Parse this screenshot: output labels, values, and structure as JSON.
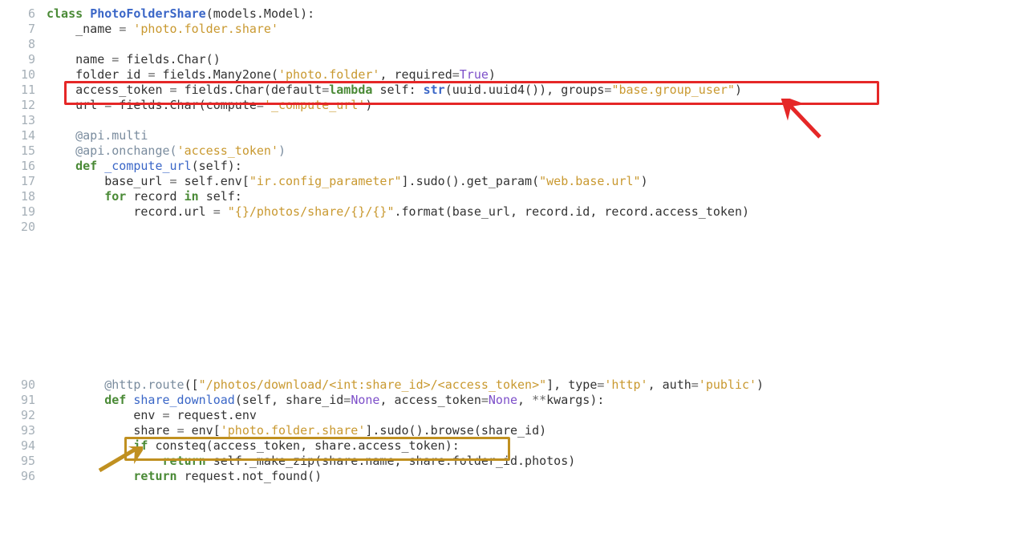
{
  "block1": {
    "lines": [
      {
        "n": 6,
        "tokens": [
          {
            "t": "class ",
            "c": "kw"
          },
          {
            "t": "PhotoFolderShare",
            "c": "cls"
          },
          {
            "t": "(models.Model):",
            "c": "nm"
          }
        ]
      },
      {
        "n": 7,
        "tokens": [
          {
            "t": "    _name ",
            "c": "nm"
          },
          {
            "t": "=",
            "c": "op"
          },
          {
            "t": " ",
            "c": "nm"
          },
          {
            "t": "'photo.folder.share'",
            "c": "str"
          }
        ]
      },
      {
        "n": 8,
        "tokens": [
          {
            "t": "",
            "c": "nm"
          }
        ]
      },
      {
        "n": 9,
        "tokens": [
          {
            "t": "    name ",
            "c": "nm"
          },
          {
            "t": "=",
            "c": "op"
          },
          {
            "t": " fields.Char()",
            "c": "nm"
          }
        ]
      },
      {
        "n": 10,
        "tokens": [
          {
            "t": "    folder_id ",
            "c": "nm"
          },
          {
            "t": "=",
            "c": "op"
          },
          {
            "t": " fields.Many2one(",
            "c": "nm"
          },
          {
            "t": "'photo.folder'",
            "c": "str"
          },
          {
            "t": ", required",
            "c": "nm"
          },
          {
            "t": "=",
            "c": "op"
          },
          {
            "t": "True",
            "c": "lit"
          },
          {
            "t": ")",
            "c": "nm"
          }
        ]
      },
      {
        "n": 11,
        "tokens": [
          {
            "t": "    access_token ",
            "c": "nm"
          },
          {
            "t": "=",
            "c": "op"
          },
          {
            "t": " fields.Char(default",
            "c": "nm"
          },
          {
            "t": "=",
            "c": "op"
          },
          {
            "t": "lambda ",
            "c": "kw"
          },
          {
            "t": "self",
            "c": "nm"
          },
          {
            "t": ": ",
            "c": "nm"
          },
          {
            "t": "str",
            "c": "cls"
          },
          {
            "t": "(uuid.uuid4()), groups",
            "c": "nm"
          },
          {
            "t": "=",
            "c": "op"
          },
          {
            "t": "\"base.group_user\"",
            "c": "str"
          },
          {
            "t": ")",
            "c": "nm"
          }
        ]
      },
      {
        "n": 12,
        "tokens": [
          {
            "t": "    url ",
            "c": "nm"
          },
          {
            "t": "=",
            "c": "op"
          },
          {
            "t": " fields.Char(compute",
            "c": "nm"
          },
          {
            "t": "=",
            "c": "op"
          },
          {
            "t": "'_compute_url'",
            "c": "str"
          },
          {
            "t": ")",
            "c": "nm"
          }
        ]
      },
      {
        "n": 13,
        "tokens": [
          {
            "t": "",
            "c": "nm"
          }
        ]
      },
      {
        "n": 14,
        "tokens": [
          {
            "t": "    ",
            "c": "nm"
          },
          {
            "t": "@api.multi",
            "c": "dec"
          }
        ]
      },
      {
        "n": 15,
        "tokens": [
          {
            "t": "    ",
            "c": "nm"
          },
          {
            "t": "@api.onchange",
            "c": "dec"
          },
          {
            "t": "(",
            "c": "dec"
          },
          {
            "t": "'access_token'",
            "c": "str"
          },
          {
            "t": ")",
            "c": "dec"
          }
        ]
      },
      {
        "n": 16,
        "tokens": [
          {
            "t": "    ",
            "c": "nm"
          },
          {
            "t": "def ",
            "c": "kw"
          },
          {
            "t": "_compute_url",
            "c": "fn"
          },
          {
            "t": "(",
            "c": "nm"
          },
          {
            "t": "self",
            "c": "nm"
          },
          {
            "t": "):",
            "c": "nm"
          }
        ]
      },
      {
        "n": 17,
        "tokens": [
          {
            "t": "        base_url ",
            "c": "nm"
          },
          {
            "t": "=",
            "c": "op"
          },
          {
            "t": " self.env[",
            "c": "nm"
          },
          {
            "t": "\"ir.config_parameter\"",
            "c": "str"
          },
          {
            "t": "].sudo().get_param(",
            "c": "nm"
          },
          {
            "t": "\"web.base.url\"",
            "c": "str"
          },
          {
            "t": ")",
            "c": "nm"
          }
        ]
      },
      {
        "n": 18,
        "tokens": [
          {
            "t": "        ",
            "c": "nm"
          },
          {
            "t": "for ",
            "c": "kw"
          },
          {
            "t": "record ",
            "c": "nm"
          },
          {
            "t": "in ",
            "c": "kw"
          },
          {
            "t": "self:",
            "c": "nm"
          }
        ]
      },
      {
        "n": 19,
        "tokens": [
          {
            "t": "            record.url ",
            "c": "nm"
          },
          {
            "t": "=",
            "c": "op"
          },
          {
            "t": " ",
            "c": "nm"
          },
          {
            "t": "\"{}/photos/share/{}/{}\"",
            "c": "str"
          },
          {
            "t": ".format(base_url, record.id, record.access_token)",
            "c": "nm"
          }
        ]
      },
      {
        "n": 20,
        "tokens": [
          {
            "t": "",
            "c": "nm"
          }
        ]
      }
    ],
    "highlight": {
      "line": 11,
      "color": "red"
    },
    "arrow": {
      "pointing_to_line": 11,
      "direction": "up-left",
      "color": "red"
    }
  },
  "block2": {
    "lines": [
      {
        "n": 90,
        "tokens": [
          {
            "t": "        ",
            "c": "nm"
          },
          {
            "t": "@http.route",
            "c": "dec"
          },
          {
            "t": "([",
            "c": "nm"
          },
          {
            "t": "\"/photos/download/<int:share_id>/<access_token>\"",
            "c": "str"
          },
          {
            "t": "], type",
            "c": "nm"
          },
          {
            "t": "=",
            "c": "op"
          },
          {
            "t": "'http'",
            "c": "str"
          },
          {
            "t": ", auth",
            "c": "nm"
          },
          {
            "t": "=",
            "c": "op"
          },
          {
            "t": "'public'",
            "c": "str"
          },
          {
            "t": ")",
            "c": "nm"
          }
        ]
      },
      {
        "n": 91,
        "tokens": [
          {
            "t": "        ",
            "c": "nm"
          },
          {
            "t": "def ",
            "c": "kw"
          },
          {
            "t": "share_download",
            "c": "fn"
          },
          {
            "t": "(",
            "c": "nm"
          },
          {
            "t": "self",
            "c": "nm"
          },
          {
            "t": ", share_id",
            "c": "nm"
          },
          {
            "t": "=",
            "c": "op"
          },
          {
            "t": "None",
            "c": "lit"
          },
          {
            "t": ", access_token",
            "c": "nm"
          },
          {
            "t": "=",
            "c": "op"
          },
          {
            "t": "None",
            "c": "lit"
          },
          {
            "t": ", ",
            "c": "nm"
          },
          {
            "t": "**",
            "c": "op"
          },
          {
            "t": "kwargs):",
            "c": "nm"
          }
        ]
      },
      {
        "n": 92,
        "tokens": [
          {
            "t": "            env ",
            "c": "nm"
          },
          {
            "t": "=",
            "c": "op"
          },
          {
            "t": " request.env",
            "c": "nm"
          }
        ]
      },
      {
        "n": 93,
        "tokens": [
          {
            "t": "            share ",
            "c": "nm"
          },
          {
            "t": "=",
            "c": "op"
          },
          {
            "t": " env[",
            "c": "nm"
          },
          {
            "t": "'photo.folder.share'",
            "c": "str"
          },
          {
            "t": "].sudo().browse(share_id)",
            "c": "nm"
          }
        ]
      },
      {
        "n": 94,
        "tokens": [
          {
            "t": "            ",
            "c": "nm"
          },
          {
            "t": "if ",
            "c": "kw"
          },
          {
            "t": "consteq(access_token, share.access_token):",
            "c": "nm"
          }
        ]
      },
      {
        "n": 95,
        "tokens": [
          {
            "t": "                ",
            "c": "nm"
          },
          {
            "t": "return ",
            "c": "kw"
          },
          {
            "t": "self._make_zip(share.name, share.folder_id.photos)",
            "c": "nm"
          }
        ]
      },
      {
        "n": 96,
        "tokens": [
          {
            "t": "            ",
            "c": "nm"
          },
          {
            "t": "return ",
            "c": "kw"
          },
          {
            "t": "request.not_found()",
            "c": "nm"
          }
        ]
      }
    ],
    "highlight": {
      "line": 94,
      "color": "gold"
    },
    "arrow": {
      "pointing_to_line": 94,
      "direction": "right",
      "color": "gold"
    }
  }
}
